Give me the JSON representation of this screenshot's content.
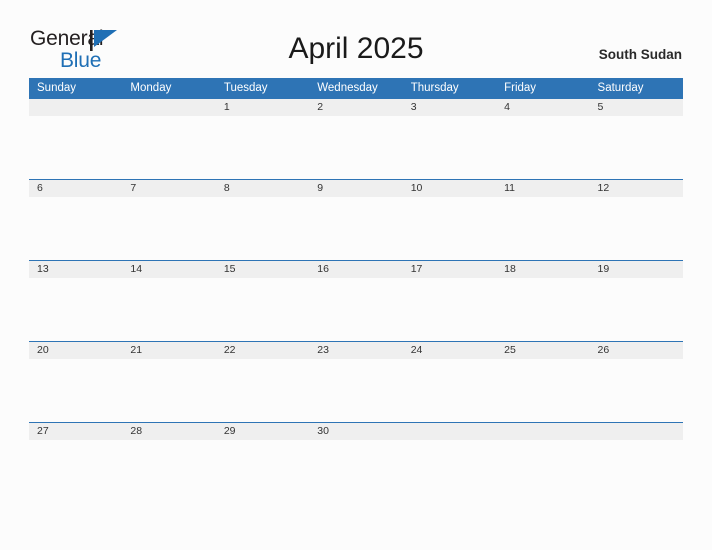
{
  "brand": {
    "line1": "General",
    "line2": "Blue",
    "flag_icon": "blue-flag-triangle-icon",
    "accent_color": "#1f6fb5",
    "text_color": "#231f20"
  },
  "header": {
    "title": "April 2025",
    "region": "South Sudan"
  },
  "theme": {
    "header_blue": "#2e74b5",
    "daynum_band": "#efefef",
    "page_background": "#fcfcfc"
  },
  "calendar": {
    "weekday_headers": [
      "Sunday",
      "Monday",
      "Tuesday",
      "Wednesday",
      "Thursday",
      "Friday",
      "Saturday"
    ],
    "weeks": [
      [
        "",
        "",
        "1",
        "2",
        "3",
        "4",
        "5"
      ],
      [
        "6",
        "7",
        "8",
        "9",
        "10",
        "11",
        "12"
      ],
      [
        "13",
        "14",
        "15",
        "16",
        "17",
        "18",
        "19"
      ],
      [
        "20",
        "21",
        "22",
        "23",
        "24",
        "25",
        "26"
      ],
      [
        "27",
        "28",
        "29",
        "30",
        "",
        "",
        ""
      ]
    ]
  }
}
